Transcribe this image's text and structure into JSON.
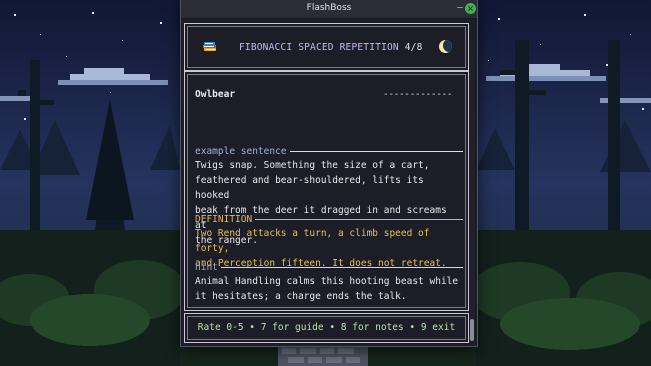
{
  "window": {
    "title": "FlashBoss"
  },
  "header": {
    "icon": "books-icon",
    "title": "FIBONACCI SPACED REPETITION",
    "progress": "4/8",
    "theme_icon": "crescent-moon-icon"
  },
  "card": {
    "term": "Owlbear",
    "term_rule": "-------------",
    "sections": [
      {
        "label": "example sentence",
        "text": "Twigs snap. Something the size of a cart,\nfeathered and bear-shouldered, lifts its hooked\nbeak from the deer it dragged in and screams at\nthe ranger."
      },
      {
        "label": "DEFINITION",
        "text": "Two Rend attacks a turn, a climb speed of forty,\nand Perception fifteen. It does not retreat."
      },
      {
        "label": "hint",
        "text": "Animal Handling calms this hooting beast while\nit hesitates; a charge ends the talk."
      }
    ]
  },
  "footer": {
    "help": "Rate 0-5 • 7 for guide • 8 for notes • 9 exit"
  },
  "colors": {
    "accent_purple": "#c7b6f0",
    "definition_gold": "#e7c24f",
    "footer_green": "#b7e3a3",
    "close_button": "#3cb54a"
  }
}
